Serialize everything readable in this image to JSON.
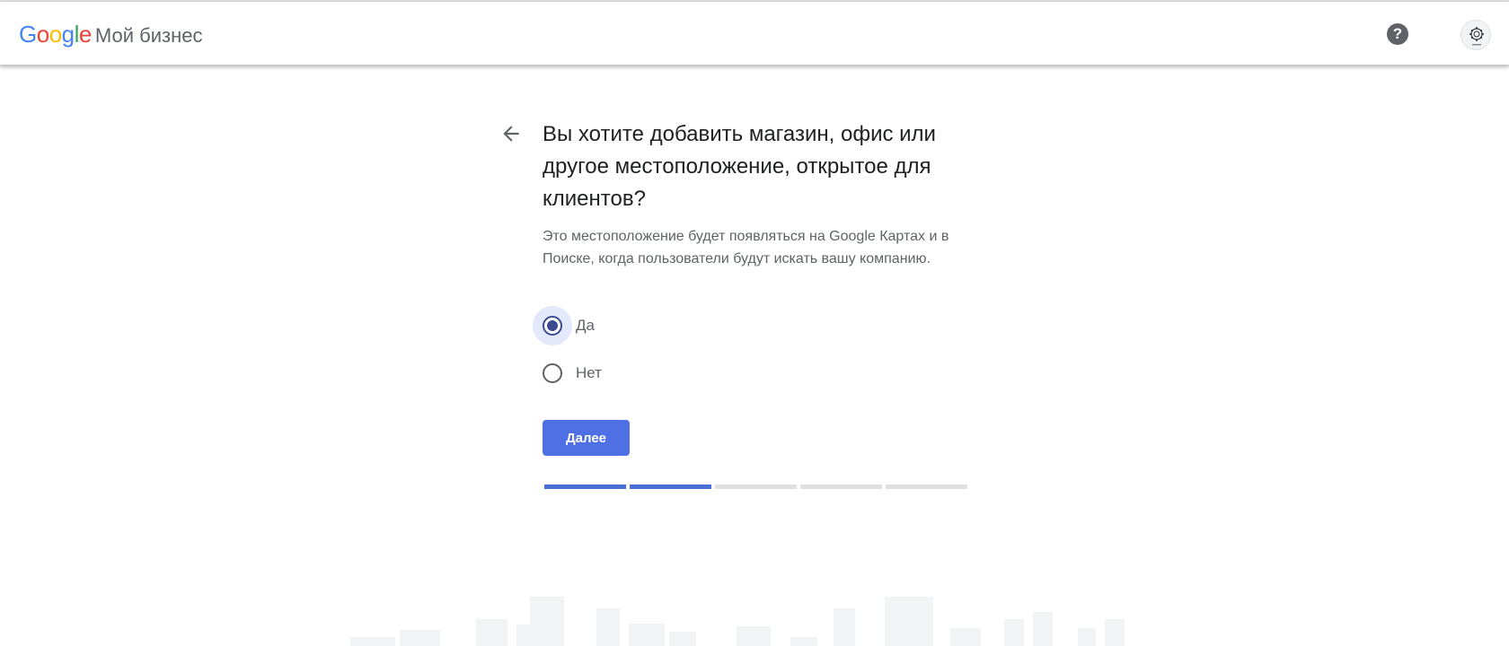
{
  "header": {
    "logo_letters": [
      "G",
      "o",
      "o",
      "g",
      "l",
      "e"
    ],
    "logo_colors": [
      "#4285f4",
      "#ea4335",
      "#fbbc05",
      "#4285f4",
      "#34a853",
      "#ea4335"
    ],
    "product_name": "Мой бизнес",
    "help_icon": "?",
    "icons": [
      "help-icon",
      "avatar"
    ]
  },
  "main": {
    "title": "Вы хотите добавить магазин, офис или другое местоположение, открытое для клиентов?",
    "subtitle": "Это местоположение будет появляться на Google Картах и в Поиске, когда пользователи будут искать вашу компанию.",
    "options": [
      {
        "label": "Да",
        "selected": true
      },
      {
        "label": "Нет",
        "selected": false
      }
    ],
    "next_label": "Далее",
    "progress": {
      "total_steps": 5,
      "completed_steps": 2
    }
  },
  "colors": {
    "accent": "#4f6fe5",
    "radio_selected": "#3c4a8f",
    "progress_done": "#4a6fd6",
    "progress_todo": "#e0e0e0"
  }
}
